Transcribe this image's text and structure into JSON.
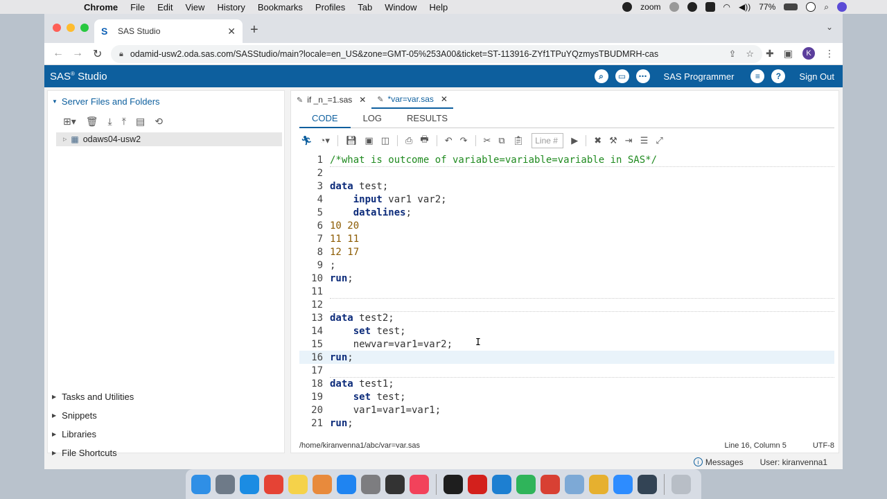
{
  "mac_menubar": {
    "apple": "",
    "items": [
      "Chrome",
      "File",
      "Edit",
      "View",
      "History",
      "Bookmarks",
      "Profiles",
      "Tab",
      "Window",
      "Help"
    ],
    "zoom_label": "zoom",
    "battery": "77%"
  },
  "browser": {
    "tab_title": "SAS Studio",
    "url": "odamid-usw2.oda.sas.com/SASStudio/main?locale=en_US&zone=GMT-05%253A00&ticket=ST-113916-ZYf1TPuYQzmysTBUDMRH-cas",
    "profile_initial": "K"
  },
  "sas_header": {
    "brand": "SAS",
    "brand_suffix": " Studio",
    "mode": "SAS Programmer",
    "sign_out": "Sign Out"
  },
  "left_pane": {
    "server_files_label": "Server Files and Folders",
    "server_node": "odaws04-usw2",
    "sections": [
      "Tasks and Utilities",
      "Snippets",
      "Libraries",
      "File Shortcuts"
    ]
  },
  "editor": {
    "file_tabs": [
      {
        "label": "if _n_=1.sas",
        "active": false
      },
      {
        "label": "*var=var.sas",
        "active": true
      }
    ],
    "subtabs": [
      "CODE",
      "LOG",
      "RESULTS"
    ],
    "line_placeholder": "Line #",
    "lines": [
      {
        "n": "1",
        "tokens": [
          {
            "t": "/*what is outcome of variable=variable=variable in SAS*/",
            "c": "comment"
          }
        ]
      },
      {
        "n": "2",
        "tokens": []
      },
      {
        "n": "3",
        "tokens": [
          {
            "t": "data",
            "c": "kw"
          },
          {
            "t": " test;",
            "c": "text"
          }
        ]
      },
      {
        "n": "4",
        "tokens": [
          {
            "t": "    input",
            "c": "kw"
          },
          {
            "t": " var1 var2;",
            "c": "text"
          }
        ]
      },
      {
        "n": "5",
        "tokens": [
          {
            "t": "    datalines",
            "c": "kw"
          },
          {
            "t": ";",
            "c": "text"
          }
        ]
      },
      {
        "n": "6",
        "tokens": [
          {
            "t": "10 20",
            "c": "num"
          }
        ]
      },
      {
        "n": "7",
        "tokens": [
          {
            "t": "11 11",
            "c": "num"
          }
        ]
      },
      {
        "n": "8",
        "tokens": [
          {
            "t": "12 17",
            "c": "num"
          }
        ]
      },
      {
        "n": "9",
        "tokens": [
          {
            "t": ";",
            "c": "text"
          }
        ]
      },
      {
        "n": "10",
        "tokens": [
          {
            "t": "run",
            "c": "kw"
          },
          {
            "t": ";",
            "c": "text"
          }
        ]
      },
      {
        "n": "11",
        "tokens": []
      },
      {
        "n": "12",
        "tokens": []
      },
      {
        "n": "13",
        "tokens": [
          {
            "t": "data",
            "c": "kw"
          },
          {
            "t": " test2;",
            "c": "text"
          }
        ]
      },
      {
        "n": "14",
        "tokens": [
          {
            "t": "    set",
            "c": "kw"
          },
          {
            "t": " test;",
            "c": "text"
          }
        ]
      },
      {
        "n": "15",
        "tokens": [
          {
            "t": "    newvar=var1=var2;",
            "c": "text"
          }
        ]
      },
      {
        "n": "16",
        "tokens": [
          {
            "t": "run",
            "c": "kw"
          },
          {
            "t": ";",
            "c": "text"
          }
        ]
      },
      {
        "n": "17",
        "tokens": []
      },
      {
        "n": "18",
        "tokens": [
          {
            "t": "data",
            "c": "kw"
          },
          {
            "t": " test1;",
            "c": "text"
          }
        ]
      },
      {
        "n": "19",
        "tokens": [
          {
            "t": "    set",
            "c": "kw"
          },
          {
            "t": " test;",
            "c": "text"
          }
        ]
      },
      {
        "n": "20",
        "tokens": [
          {
            "t": "    var1=var1=var1;",
            "c": "text"
          }
        ]
      },
      {
        "n": "21",
        "tokens": [
          {
            "t": "run",
            "c": "kw"
          },
          {
            "t": ";",
            "c": "text"
          }
        ]
      }
    ],
    "current_line": "16",
    "file_path": "/home/kiranvenna1/abc/var=var.sas",
    "cursor_position": "Line 16, Column 5",
    "encoding": "UTF-8"
  },
  "footer": {
    "messages": "Messages",
    "user": "User: kiranvenna1"
  },
  "dock_apps": [
    {
      "name": "finder",
      "color": "#2f8fe6"
    },
    {
      "name": "launchpad",
      "color": "#6e7a88"
    },
    {
      "name": "safari",
      "color": "#1b8ce3"
    },
    {
      "name": "chrome",
      "color": "#e54335"
    },
    {
      "name": "notes",
      "color": "#f5d24a"
    },
    {
      "name": "photos",
      "color": "#e88a3c"
    },
    {
      "name": "app-store",
      "color": "#1f84f1"
    },
    {
      "name": "system-preferences",
      "color": "#7d7d80"
    },
    {
      "name": "piano",
      "color": "#333333"
    },
    {
      "name": "music",
      "color": "#f2425b"
    },
    {
      "name": "terminal",
      "color": "#1e1e1e"
    },
    {
      "name": "acrobat",
      "color": "#d3201c"
    },
    {
      "name": "vscode",
      "color": "#1d7fd1"
    },
    {
      "name": "sync",
      "color": "#2fb45a"
    },
    {
      "name": "remote",
      "color": "#d84033"
    },
    {
      "name": "folder",
      "color": "#7da9d6"
    },
    {
      "name": "slack",
      "color": "#e6b02f"
    },
    {
      "name": "zoom",
      "color": "#2d8cff"
    },
    {
      "name": "quicktime",
      "color": "#334455"
    },
    {
      "name": "trash",
      "color": "#b8bec6"
    }
  ]
}
